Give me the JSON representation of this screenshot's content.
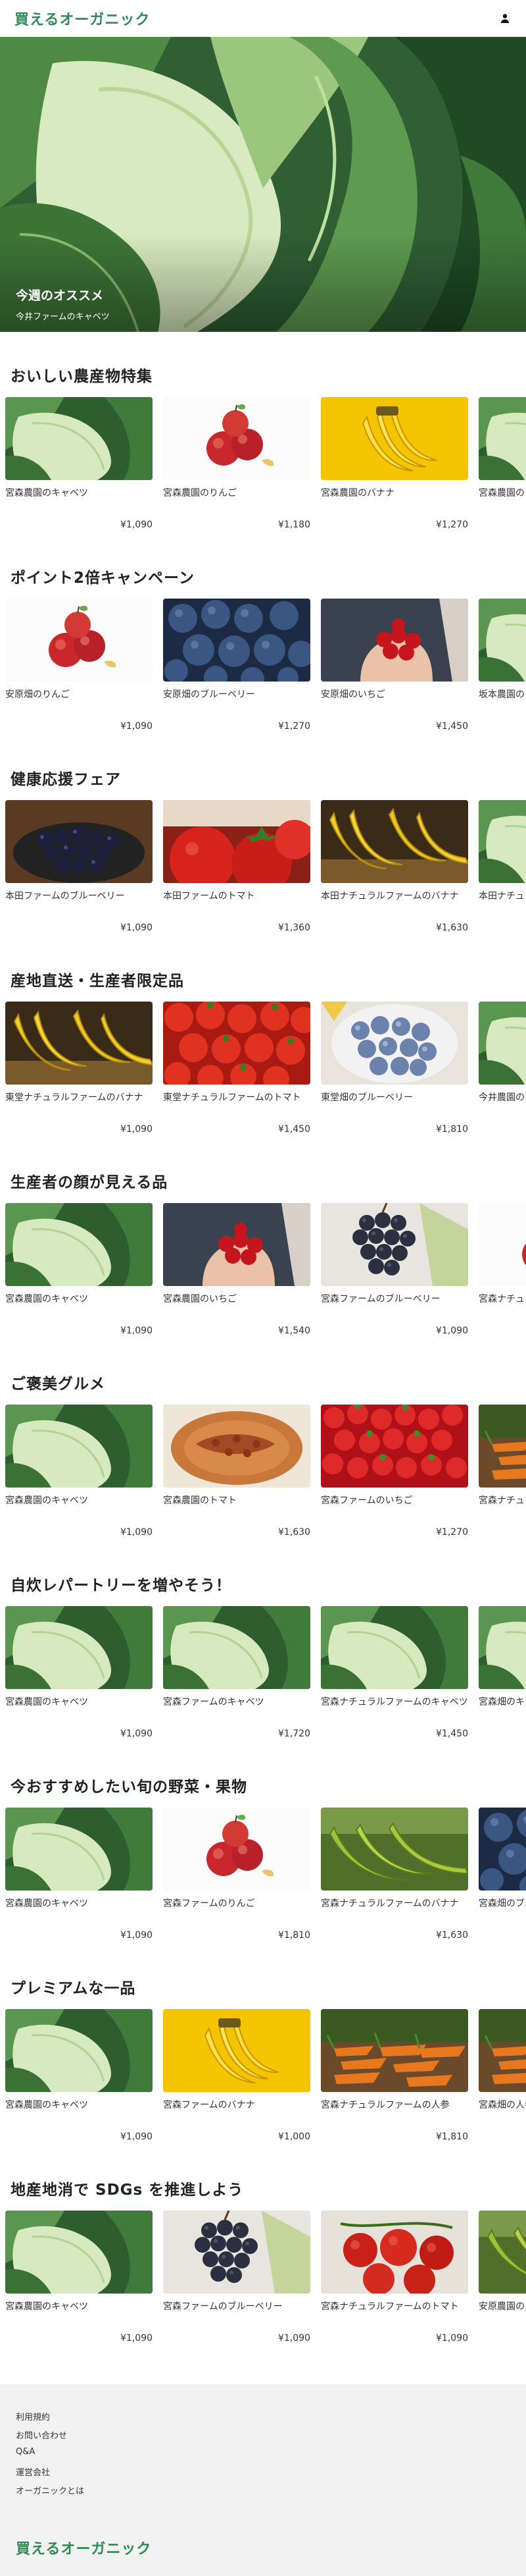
{
  "header": {
    "logo": "買えるオーガニック",
    "user_icon": "user-icon"
  },
  "hero": {
    "title": "今週のオススメ",
    "subtitle": "今井ファームのキャベツ"
  },
  "sections": [
    {
      "title": "おいしい農産物特集",
      "items": [
        {
          "name": "宮森農園のキャベツ",
          "price": "¥1,090",
          "img": "cabbage"
        },
        {
          "name": "宮森農園のりんご",
          "price": "¥1,180",
          "img": "apple"
        },
        {
          "name": "宮森農園のバナナ",
          "price": "¥1,270",
          "img": "banana-yellow"
        },
        {
          "name": "宮森農園の",
          "price": "",
          "img": "cabbage"
        }
      ]
    },
    {
      "title": "ポイント2倍キャンペーン",
      "items": [
        {
          "name": "安原畑のりんご",
          "price": "¥1,090",
          "img": "apple"
        },
        {
          "name": "安原畑のブルーベリー",
          "price": "¥1,270",
          "img": "blueberry-dark"
        },
        {
          "name": "安原畑のいちご",
          "price": "¥1,450",
          "img": "strawberry-hands"
        },
        {
          "name": "坂本農園の",
          "price": "",
          "img": "cabbage"
        }
      ]
    },
    {
      "title": "健康応援フェア",
      "items": [
        {
          "name": "本田ファームのブルーベリー",
          "price": "¥1,090",
          "img": "blueberry-bowl"
        },
        {
          "name": "本田ファームのトマト",
          "price": "¥1,360",
          "img": "tomato"
        },
        {
          "name": "本田ナチュラルファームのバナナ",
          "price": "¥1,630",
          "img": "banana-dark"
        },
        {
          "name": "本田ナチュラルファームのいちご",
          "price": "",
          "img": "cabbage"
        }
      ]
    },
    {
      "title": "産地直送・生産者限定品",
      "items": [
        {
          "name": "東堂ナチュラルファームのバナナ",
          "price": "¥1,090",
          "img": "banana-dark"
        },
        {
          "name": "東堂ナチュラルファームのトマト",
          "price": "¥1,450",
          "img": "tomatoes-red"
        },
        {
          "name": "東堂畑のブルーベリー",
          "price": "¥1,810",
          "img": "blueberry-light"
        },
        {
          "name": "今井農園の",
          "price": "",
          "img": "cabbage"
        }
      ]
    },
    {
      "title": "生産者の顔が見える品",
      "items": [
        {
          "name": "宮森農園のキャベツ",
          "price": "¥1,090",
          "img": "cabbage"
        },
        {
          "name": "宮森農園のいちご",
          "price": "¥1,540",
          "img": "strawberry-hands"
        },
        {
          "name": "宮森ファームのブルーベリー",
          "price": "¥1,090",
          "img": "grapes"
        },
        {
          "name": "宮森ナチュラルファームのりんご",
          "price": "",
          "img": "apple"
        }
      ]
    },
    {
      "title": "ご褒美グルメ",
      "items": [
        {
          "name": "宮森農園のキャベツ",
          "price": "¥1,090",
          "img": "cabbage"
        },
        {
          "name": "宮森農園のトマト",
          "price": "¥1,630",
          "img": "pie"
        },
        {
          "name": "宮森ファームのいちご",
          "price": "¥1,270",
          "img": "strawberry-pile"
        },
        {
          "name": "宮森ナチュラルファームの人参",
          "price": "",
          "img": "carrot"
        }
      ]
    },
    {
      "title": "自炊レパートリーを増やそう！",
      "items": [
        {
          "name": "宮森農園のキャベツ",
          "price": "¥1,090",
          "img": "cabbage"
        },
        {
          "name": "宮森ファームのキャベツ",
          "price": "¥1,720",
          "img": "cabbage"
        },
        {
          "name": "宮森ナチュラルファームのキャベツ",
          "price": "¥1,450",
          "img": "cabbage"
        },
        {
          "name": "宮森畑のキャベツ",
          "price": "",
          "img": "cabbage"
        }
      ]
    },
    {
      "title": "今おすすめしたい旬の野菜・果物",
      "items": [
        {
          "name": "宮森農園のキャベツ",
          "price": "¥1,090",
          "img": "cabbage"
        },
        {
          "name": "宮森ファームのりんご",
          "price": "¥1,810",
          "img": "apple"
        },
        {
          "name": "宮森ナチュラルファームのバナナ",
          "price": "¥1,630",
          "img": "banana-green"
        },
        {
          "name": "宮森畑のブルーベリー",
          "price": "",
          "img": "blueberry-dark"
        }
      ]
    },
    {
      "title": "プレミアムな一品",
      "items": [
        {
          "name": "宮森農園のキャベツ",
          "price": "¥1,090",
          "img": "cabbage"
        },
        {
          "name": "宮森ファームのバナナ",
          "price": "¥1,000",
          "img": "banana-yellow"
        },
        {
          "name": "宮森ナチュラルファームの人参",
          "price": "¥1,810",
          "img": "carrot"
        },
        {
          "name": "宮森畑の人参",
          "price": "",
          "img": "carrot"
        }
      ]
    },
    {
      "title": "地産地消で SDGs を推進しよう",
      "items": [
        {
          "name": "宮森農園のキャベツ",
          "price": "¥1,090",
          "img": "cabbage"
        },
        {
          "name": "宮森ファームのブルーベリー",
          "price": "¥1,090",
          "img": "grapes"
        },
        {
          "name": "宮森ナチュラルファームのトマト",
          "price": "¥1,090",
          "img": "tomato-vine"
        },
        {
          "name": "安原農園のバナナ",
          "price": "",
          "img": "banana-green"
        }
      ]
    }
  ],
  "footer": {
    "links": [
      "利用規約",
      "お問い合わせ",
      "Q&A",
      "運営会社",
      "オーガニックとは"
    ],
    "logo": "買えるオーガニック"
  },
  "colors": {
    "brand": "#2e8b57",
    "footer_bg": "#f2f2f2"
  }
}
